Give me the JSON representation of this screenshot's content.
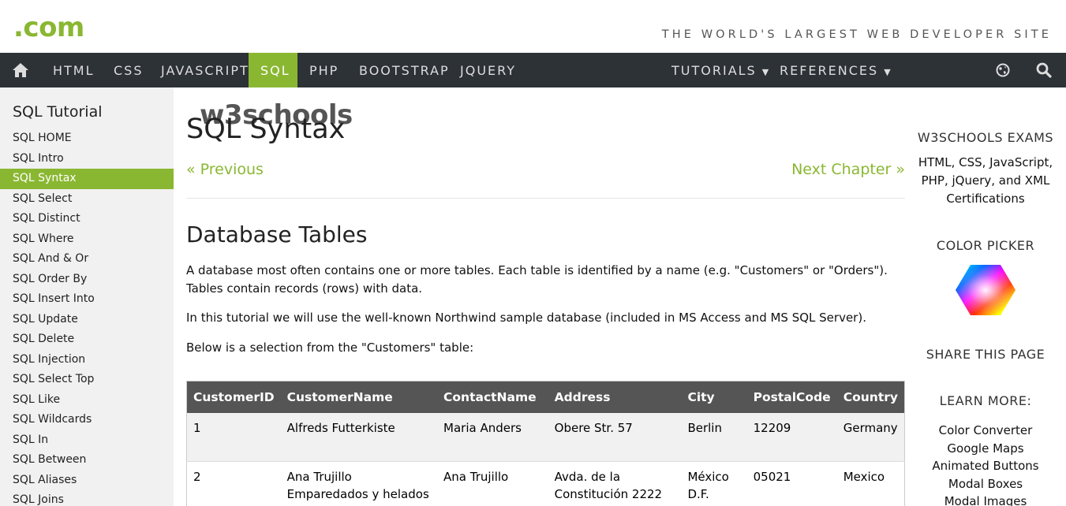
{
  "header": {
    "logo_main": "w3schools",
    "logo_tld": ".com",
    "tagline": "THE WORLD'S LARGEST WEB DEVELOPER SITE"
  },
  "nav": {
    "items": [
      "HTML",
      "CSS",
      "JAVASCRIPT",
      "SQL",
      "PHP",
      "BOOTSTRAP",
      "JQUERY"
    ],
    "active": "SQL",
    "tutorials": "TUTORIALS",
    "references": "REFERENCES",
    "icons": [
      "home-icon",
      "globe-icon",
      "search-icon"
    ]
  },
  "sidebar": {
    "title": "SQL Tutorial",
    "items": [
      "SQL HOME",
      "SQL Intro",
      "SQL Syntax",
      "SQL Select",
      "SQL Distinct",
      "SQL Where",
      "SQL And & Or",
      "SQL Order By",
      "SQL Insert Into",
      "SQL Update",
      "SQL Delete",
      "SQL Injection",
      "SQL Select Top",
      "SQL Like",
      "SQL Wildcards",
      "SQL In",
      "SQL Between",
      "SQL Aliases",
      "SQL Joins"
    ],
    "active": "SQL Syntax"
  },
  "main": {
    "title": "SQL Syntax",
    "prev": "« Previous",
    "next": "Next Chapter »",
    "section_title": "Database Tables",
    "para1": "A database most often contains one or more tables. Each table is identified by a name (e.g. \"Customers\" or \"Orders\"). Tables contain records (rows) with data.",
    "para2": "In this tutorial we will use the well-known Northwind sample database (included in MS Access and MS SQL Server).",
    "para3": "Below is a selection from the \"Customers\" table:",
    "table": {
      "headers": [
        "CustomerID",
        "CustomerName",
        "ContactName",
        "Address",
        "City",
        "PostalCode",
        "Country"
      ],
      "rows": [
        [
          "1",
          "Alfreds Futterkiste",
          "Maria Anders",
          "Obere Str. 57",
          "Berlin",
          "12209",
          "Germany"
        ],
        [
          "2",
          "Ana Trujillo Emparedados y helados",
          "Ana Trujillo",
          "Avda. de la Constitución 2222",
          "México D.F.",
          "05021",
          "Mexico"
        ]
      ]
    }
  },
  "right": {
    "exams_title": "W3SCHOOLS EXAMS",
    "exams_text": "HTML, CSS, JavaScript, PHP, jQuery, and XML Certifications",
    "color_picker_title": "COLOR PICKER",
    "share_title": "SHARE THIS PAGE",
    "learn_title": "LEARN MORE:",
    "learn_links": [
      "Color Converter",
      "Google Maps",
      "Animated Buttons",
      "Modal Boxes",
      "Modal Images"
    ]
  },
  "colors": {
    "accent": "#8ab732",
    "nav_bg": "#2d3237",
    "table_header": "#555555"
  }
}
